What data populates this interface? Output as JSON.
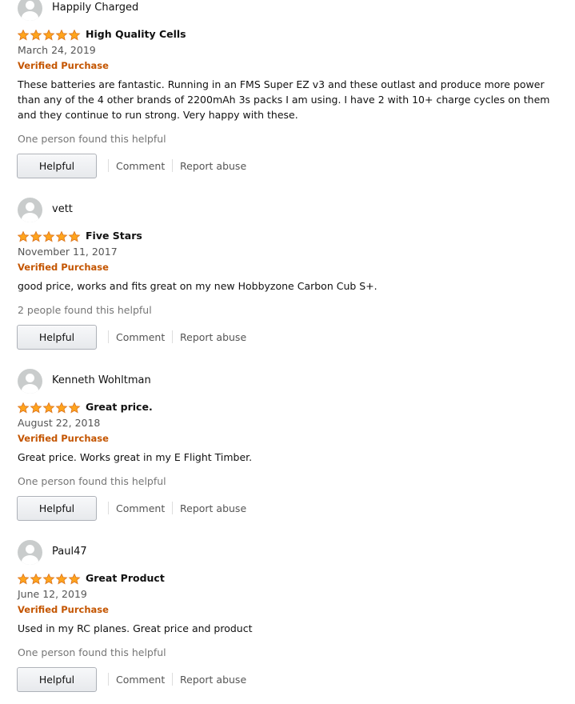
{
  "colors": {
    "star": "#ffa41c",
    "star_stroke": "#de7921",
    "verified": "#c45500"
  },
  "icons": {
    "avatar": "default-avatar-icon",
    "star": "star-icon"
  },
  "common": {
    "verified_label": "Verified Purchase",
    "helpful_label": "Helpful",
    "comment_label": "Comment",
    "report_label": "Report abuse"
  },
  "reviews": [
    {
      "name": "Happily Charged",
      "rating": 5,
      "title": "High Quality Cells",
      "date": "March 24, 2019",
      "body": "These batteries are fantastic. Running in an FMS Super EZ v3 and these outlast and produce more power than any of the 4 other brands of 2200mAh 3s packs I am using. I have 2 with 10+ charge cycles on them and they continue to run strong. Very happy with these.",
      "helpful_count": "One person found this helpful"
    },
    {
      "name": "vett",
      "rating": 5,
      "title": "Five Stars",
      "date": "November 11, 2017",
      "body": "good price, works and fits great on my new Hobbyzone Carbon Cub S+.",
      "helpful_count": "2 people found this helpful"
    },
    {
      "name": "Kenneth Wohltman",
      "rating": 5,
      "title": "Great price.",
      "date": "August 22, 2018",
      "body": "Great price. Works great in my E Flight Timber.",
      "helpful_count": "One person found this helpful"
    },
    {
      "name": "Paul47",
      "rating": 5,
      "title": "Great Product",
      "date": "June 12, 2019",
      "body": "Used in my RC planes. Great price and product",
      "helpful_count": "One person found this helpful"
    }
  ]
}
